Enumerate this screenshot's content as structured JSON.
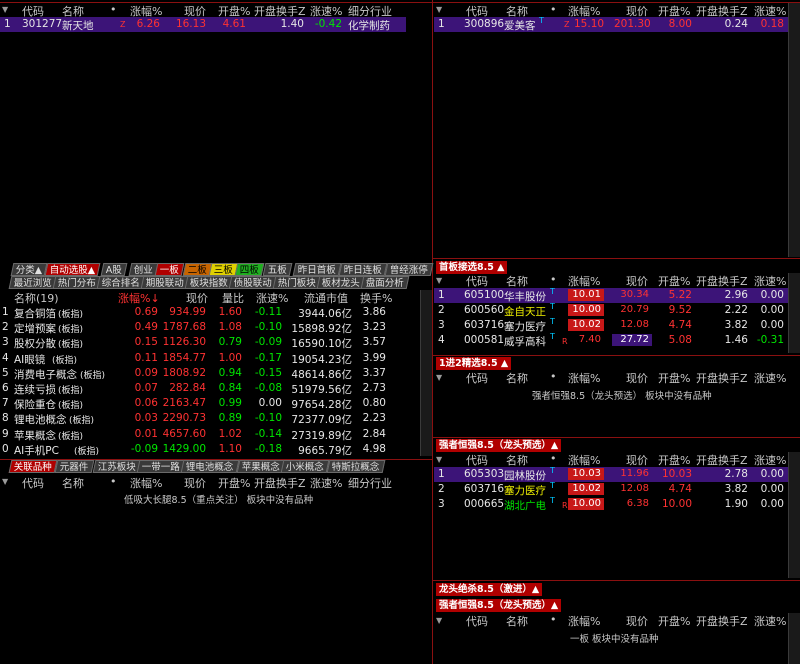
{
  "top_left": {
    "headers": [
      "代码",
      "名称",
      "•",
      "涨幅%",
      "现价",
      "开盘%",
      "开盘换手Z",
      "涨速%",
      "细分行业"
    ],
    "rows": [
      {
        "idx": "1",
        "code": "301277",
        "name": "新天地",
        "flag": "Z",
        "chg": "6.26",
        "price": "16.13",
        "open": "4.61",
        "turnover": "1.40",
        "speed": "-0.42",
        "industry": "化学制药"
      }
    ]
  },
  "top_right": {
    "headers": [
      "代码",
      "名称",
      "•",
      "涨幅%",
      "现价",
      "开盘%",
      "开盘换手Z",
      "涨速%"
    ],
    "rows": [
      {
        "idx": "1",
        "code": "300896",
        "name": "爱美客",
        "sup": "T",
        "flag": "Z",
        "chg": "15.10",
        "price": "201.30",
        "open": "8.00",
        "turnover": "0.24",
        "speed": "0.18"
      }
    ]
  },
  "tabs_row1": [
    "分类▲",
    "自动选股▲",
    "A股",
    "创业",
    "一板",
    "二板",
    "三板",
    "四板",
    "五板",
    "昨日首板",
    "昨日连板",
    "曾经涨停"
  ],
  "tabs_row2": [
    "最近浏览",
    "热门分布",
    "综合排名",
    "期股联动",
    "板块指数",
    "债股联动",
    "热门板块",
    "板材龙头",
    "盘面分析"
  ],
  "sector": {
    "headers": [
      "名称(19)",
      "涨幅%↓",
      "现价",
      "量比",
      "涨速%",
      "流通市值",
      "换手%"
    ],
    "rows": [
      {
        "idx": "1",
        "name": "复合铜箔",
        "tag": "(板指)",
        "chg": "0.69",
        "price": "934.99",
        "ratio": "1.60",
        "speed": "-0.11",
        "cap": "3944.06亿",
        "turn": "3.86"
      },
      {
        "idx": "2",
        "name": "定增预案",
        "tag": "(板指)",
        "chg": "0.49",
        "price": "1787.68",
        "ratio": "1.08",
        "speed": "-0.10",
        "cap": "15898.92亿",
        "turn": "3.23"
      },
      {
        "idx": "3",
        "name": "股权分散",
        "tag": "(板指)",
        "chg": "0.15",
        "price": "1126.30",
        "ratio": "0.79",
        "speed": "-0.09",
        "cap": "16590.10亿",
        "turn": "3.57"
      },
      {
        "idx": "4",
        "name": "AI眼镜",
        "tag": "(板指)",
        "chg": "0.11",
        "price": "1854.77",
        "ratio": "1.00",
        "speed": "-0.17",
        "cap": "19054.23亿",
        "turn": "3.99"
      },
      {
        "idx": "5",
        "name": "消费电子概念",
        "tag": "(板指)",
        "chg": "0.09",
        "price": "1808.92",
        "ratio": "0.94",
        "speed": "-0.15",
        "cap": "48614.86亿",
        "turn": "3.37"
      },
      {
        "idx": "6",
        "name": "连续亏损",
        "tag": "(板指)",
        "chg": "0.07",
        "price": "282.84",
        "ratio": "0.84",
        "speed": "-0.08",
        "cap": "51979.56亿",
        "turn": "2.73"
      },
      {
        "idx": "7",
        "name": "保险重仓",
        "tag": "(板指)",
        "chg": "0.06",
        "price": "2163.47",
        "ratio": "0.99",
        "speed": "0.00",
        "cap": "97654.28亿",
        "turn": "0.80"
      },
      {
        "idx": "8",
        "name": "锂电池概念",
        "tag": "(板指)",
        "chg": "0.03",
        "price": "2290.73",
        "ratio": "0.89",
        "speed": "-0.10",
        "cap": "72377.09亿",
        "turn": "2.23"
      },
      {
        "idx": "9",
        "name": "苹果概念",
        "tag": "(板指)",
        "chg": "0.01",
        "price": "4657.60",
        "ratio": "1.02",
        "speed": "-0.14",
        "cap": "27319.89亿",
        "turn": "2.84"
      },
      {
        "idx": "0",
        "name": "AI手机PC",
        "tag": "(板指)",
        "chg": "-0.09",
        "price": "1429.00",
        "ratio": "1.10",
        "speed": "-0.18",
        "cap": "9665.79亿",
        "turn": "4.98"
      }
    ]
  },
  "tabs_row3": [
    "关联品种",
    "元器件",
    "江苏板块",
    "一带一路",
    "锂电池概念",
    "苹果概念",
    "小米概念",
    "特斯拉概念"
  ],
  "bottom_left": {
    "headers": [
      "代码",
      "名称",
      "•",
      "涨幅%",
      "现价",
      "开盘%",
      "开盘换手Z",
      "涨速%",
      "细分行业"
    ],
    "message": "低吸大长腿8.5（重点关注） 板块中没有品种"
  },
  "panel_first": {
    "title": "首板接选8.5 ▲",
    "headers": [
      "代码",
      "名称",
      "•",
      "涨幅%",
      "现价",
      "开盘%",
      "开盘换手Z",
      "涨速%"
    ],
    "rows": [
      {
        "idx": "1",
        "code": "605100",
        "name": "华丰股份",
        "sup": "T",
        "flag": "",
        "chg": "10.01",
        "price": "30.34",
        "open": "5.22",
        "turnover": "2.96",
        "speed": "0.00"
      },
      {
        "idx": "2",
        "code": "600560",
        "name": "金自天正",
        "sup": "T",
        "flag": "",
        "chg": "10.00",
        "price": "20.79",
        "open": "9.52",
        "turnover": "2.22",
        "speed": "0.00"
      },
      {
        "idx": "3",
        "code": "603716",
        "name": "塞力医疗",
        "sup": "T",
        "flag": "",
        "chg": "10.02",
        "price": "12.08",
        "open": "4.74",
        "turnover": "3.82",
        "speed": "0.00"
      },
      {
        "idx": "4",
        "code": "000581",
        "name": "威孚高科",
        "sup": "T",
        "flag": "R",
        "chg": "7.40",
        "price": "27.72",
        "open": "5.08",
        "turnover": "1.46",
        "speed": "-0.31"
      }
    ]
  },
  "panel_second": {
    "title": "1进2精选8.5 ▲",
    "headers": [
      "代码",
      "名称",
      "•",
      "涨幅%",
      "现价",
      "开盘%",
      "开盘换手Z",
      "涨速%"
    ],
    "message": "强者恒强8.5（龙头预选） 板块中没有品种"
  },
  "panel_third": {
    "title": "强者恒强8.5（龙头预选）▲",
    "headers": [
      "代码",
      "名称",
      "•",
      "涨幅%",
      "现价",
      "开盘%",
      "开盘换手Z",
      "涨速%"
    ],
    "rows": [
      {
        "idx": "1",
        "code": "605303",
        "name": "园林股份",
        "sup": "T",
        "flag": "",
        "chg": "10.03",
        "price": "11.96",
        "open": "10.03",
        "turnover": "2.78",
        "speed": "0.00"
      },
      {
        "idx": "2",
        "code": "603716",
        "name": "塞力医疗",
        "sup": "T",
        "flag": "",
        "chg": "10.02",
        "price": "12.08",
        "open": "4.74",
        "turnover": "3.82",
        "speed": "0.00"
      },
      {
        "idx": "3",
        "code": "000665",
        "name": "湖北广电",
        "sup": "T",
        "flag": "R",
        "chg": "10.00",
        "price": "6.38",
        "open": "10.00",
        "turnover": "1.90",
        "speed": "0.00"
      }
    ]
  },
  "panel_fourth": {
    "title": "龙头绝杀8.5（激进）▲"
  },
  "panel_fifth": {
    "title": "强者恒强8.5（龙头预选）▲",
    "headers": [
      "代码",
      "名称",
      "•",
      "涨幅%",
      "现价",
      "开盘%",
      "开盘换手Z",
      "涨速%"
    ],
    "message": "一板 板块中没有品种"
  },
  "colors": {
    "accent": "#b00000",
    "selected_row": "#3c1478",
    "up": "#ff3232",
    "down": "#00e600"
  }
}
